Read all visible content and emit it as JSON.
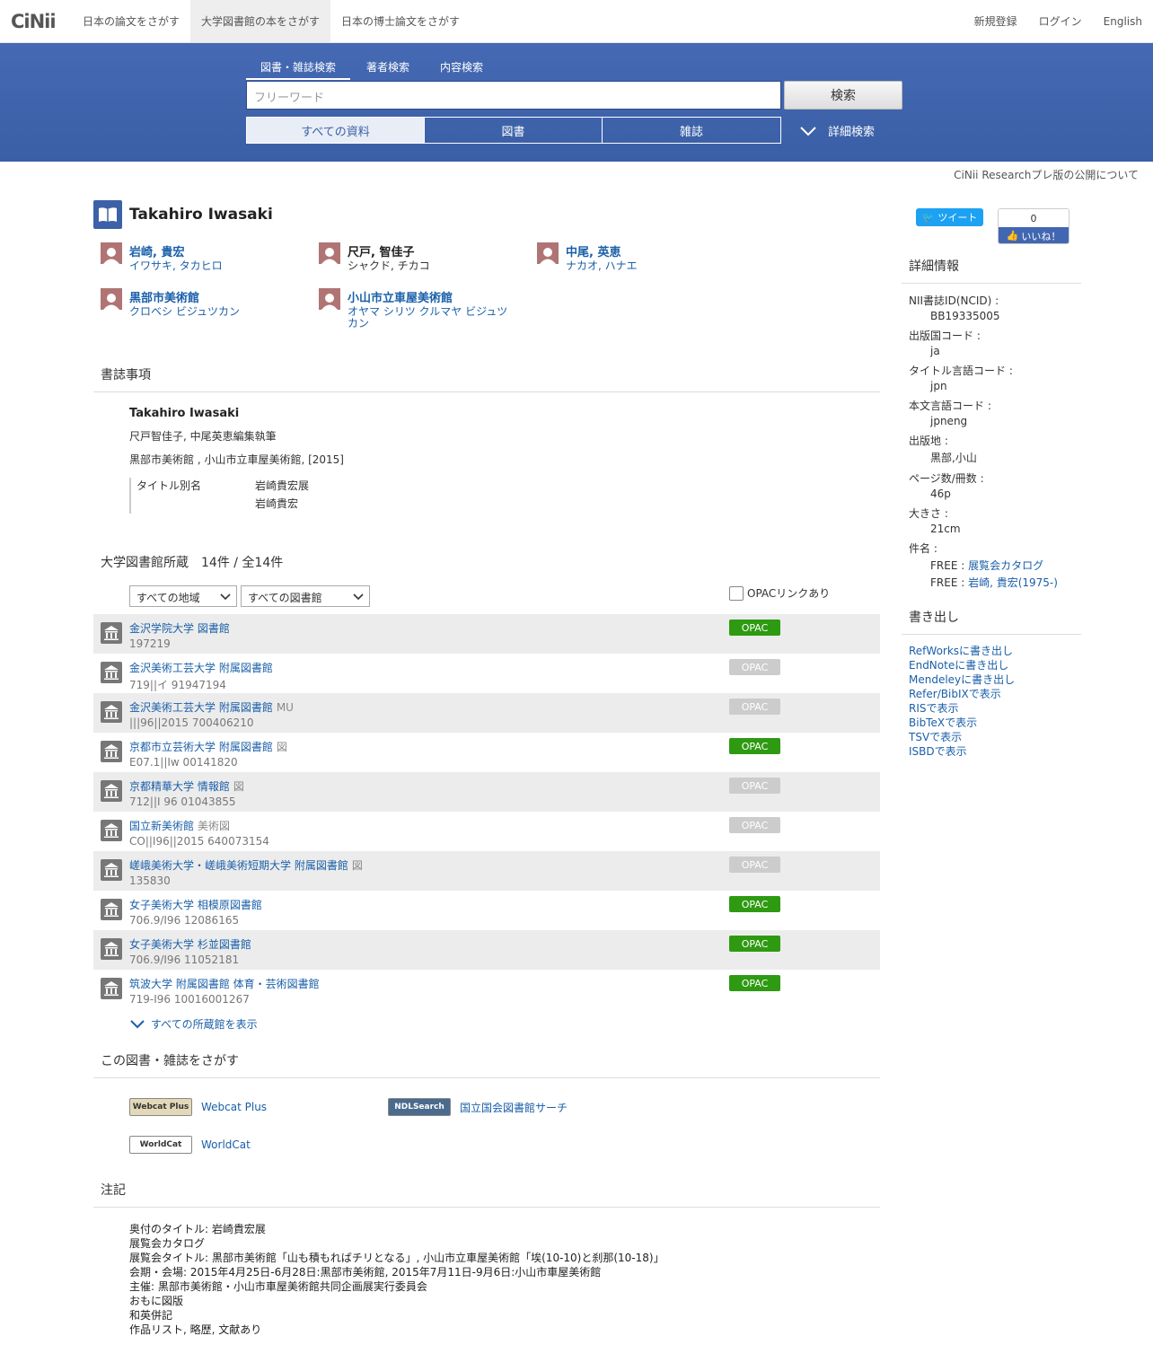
{
  "header": {
    "logo": "CiNii",
    "tabs": [
      "日本の論文をさがす",
      "大学図書館の本をさがす",
      "日本の博士論文をさがす"
    ],
    "right": [
      "新規登録",
      "ログイン",
      "English"
    ]
  },
  "search": {
    "tabs": [
      "図書・雑誌検索",
      "著者検索",
      "内容検索"
    ],
    "placeholder": "フリーワード",
    "button": "検索",
    "types": [
      "すべての資料",
      "図書",
      "雑誌"
    ],
    "advanced": "詳細検索"
  },
  "research_notice": "CiNii Researchプレ版の公開について",
  "title": "Takahiro Iwasaki",
  "authors": [
    {
      "name": "岩崎, 貴宏",
      "kana": "イワサキ, タカヒロ",
      "linked": true
    },
    {
      "name": "尺戸, 智佳子",
      "kana": "シャクド, チカコ",
      "linked": false
    },
    {
      "name": "中尾, 英恵",
      "kana": "ナカオ, ハナエ",
      "linked": true
    },
    {
      "name": "黒部市美術館",
      "kana": "クロベシ ビジュツカン",
      "linked": true
    },
    {
      "name": "小山市立車屋美術館",
      "kana": "オヤマ シリツ クルマヤ ビジュツカン",
      "linked": true
    }
  ],
  "bibliography": {
    "heading": "書誌事項",
    "title": "Takahiro Iwasaki",
    "responsibility": "尺戸智佳子, 中尾英恵編集執筆",
    "publication": "黒部市美術館 , 小山市立車屋美術館, [2015]",
    "alt_label": "タイトル別名",
    "alt_titles": [
      "岩崎貴宏展",
      "岩崎貴宏"
    ]
  },
  "holdings": {
    "heading": "大学図書館所蔵　14件 / 全14件",
    "region_select": "すべての地域",
    "library_select": "すべての図書館",
    "opac_filter": "OPACリンクあり",
    "opac_label": "OPAC",
    "rows": [
      {
        "name": "金沢学院大学 図書館",
        "loc": "",
        "call": "197219",
        "opac": true
      },
      {
        "name": "金沢美術工芸大学 附属図書館",
        "loc": "",
        "call": "719||イ  91947194",
        "opac": false
      },
      {
        "name": "金沢美術工芸大学 附属図書館",
        "loc": "MU",
        "call": "|||96||2015  700406210",
        "opac": false
      },
      {
        "name": "京都市立芸術大学 附属図書館",
        "loc": "図",
        "call": "E07.1||Iw  00141820",
        "opac": true
      },
      {
        "name": "京都精華大学 情報館",
        "loc": "図",
        "call": "712||I 96  01043855",
        "opac": false
      },
      {
        "name": "国立新美術館",
        "loc": "美術図",
        "call": "CO||I96||2015  640073154",
        "opac": false
      },
      {
        "name": "嵯峨美術大学・嵯峨美術短期大学 附属図書館",
        "loc": "図",
        "call": "135830",
        "opac": false
      },
      {
        "name": "女子美術大学 相模原図書館",
        "loc": "",
        "call": "706.9/I96  12086165",
        "opac": true
      },
      {
        "name": "女子美術大学 杉並図書館",
        "loc": "",
        "call": "706.9/I96  11052181",
        "opac": true
      },
      {
        "name": "筑波大学 附属図書館 体育・芸術図書館",
        "loc": "",
        "call": "719-I96  10016001267",
        "opac": true
      }
    ],
    "show_all": "すべての所蔵館を表示"
  },
  "external": {
    "heading": "この図書・雑誌をさがす",
    "items": [
      {
        "badge": "Webcat Plus",
        "label": "Webcat Plus"
      },
      {
        "badge": "NDLSearch",
        "label": "国立国会図書館サーチ"
      },
      {
        "badge": "WorldCat",
        "label": "WorldCat"
      }
    ]
  },
  "notes": {
    "heading": "注記",
    "lines": [
      "奥付のタイトル: 岩崎貴宏展",
      "展覧会カタログ",
      "展覧会タイトル: 黒部市美術館「山も積もればチリとなる」, 小山市立車屋美術館「埃(10-10)と刹那(10-18)」",
      "会期・会場: 2015年4月25日-6月28日:黒部市美術館, 2015年7月11日-9月6日:小山市車屋美術館",
      "主催: 黒部市美術館・小山市車屋美術館共同企画展実行委員会",
      "おもに図版",
      "和英併記",
      "作品リスト, 略歴, 文献あり"
    ]
  },
  "sidebar": {
    "tweet": "ツイート",
    "like_count": "0",
    "like": "いいね！",
    "details_heading": "詳細情報",
    "details": [
      {
        "label": "NII書誌ID(NCID) :",
        "value": "BB19335005"
      },
      {
        "label": "出版国コード :",
        "value": "ja"
      },
      {
        "label": "タイトル言語コード :",
        "value": "jpn"
      },
      {
        "label": "本文言語コード :",
        "value": "jpneng"
      },
      {
        "label": "出版地 :",
        "value": "黒部,小山"
      },
      {
        "label": "ページ数/冊数 :",
        "value": "46p"
      },
      {
        "label": "大きさ :",
        "value": "21cm"
      }
    ],
    "subject_label": "件名 :",
    "subjects": [
      {
        "prefix": "FREE : ",
        "link": "展覧会カタログ"
      },
      {
        "prefix": "FREE : ",
        "link": "岩崎, 貴宏(1975-)"
      }
    ],
    "export_heading": "書き出し",
    "exports": [
      "RefWorksに書き出し",
      "EndNoteに書き出し",
      "Mendeleyに書き出し",
      "Refer/BibIXで表示",
      "RISで表示",
      "BibTeXで表示",
      "TSVで表示",
      "ISBDで表示"
    ]
  }
}
